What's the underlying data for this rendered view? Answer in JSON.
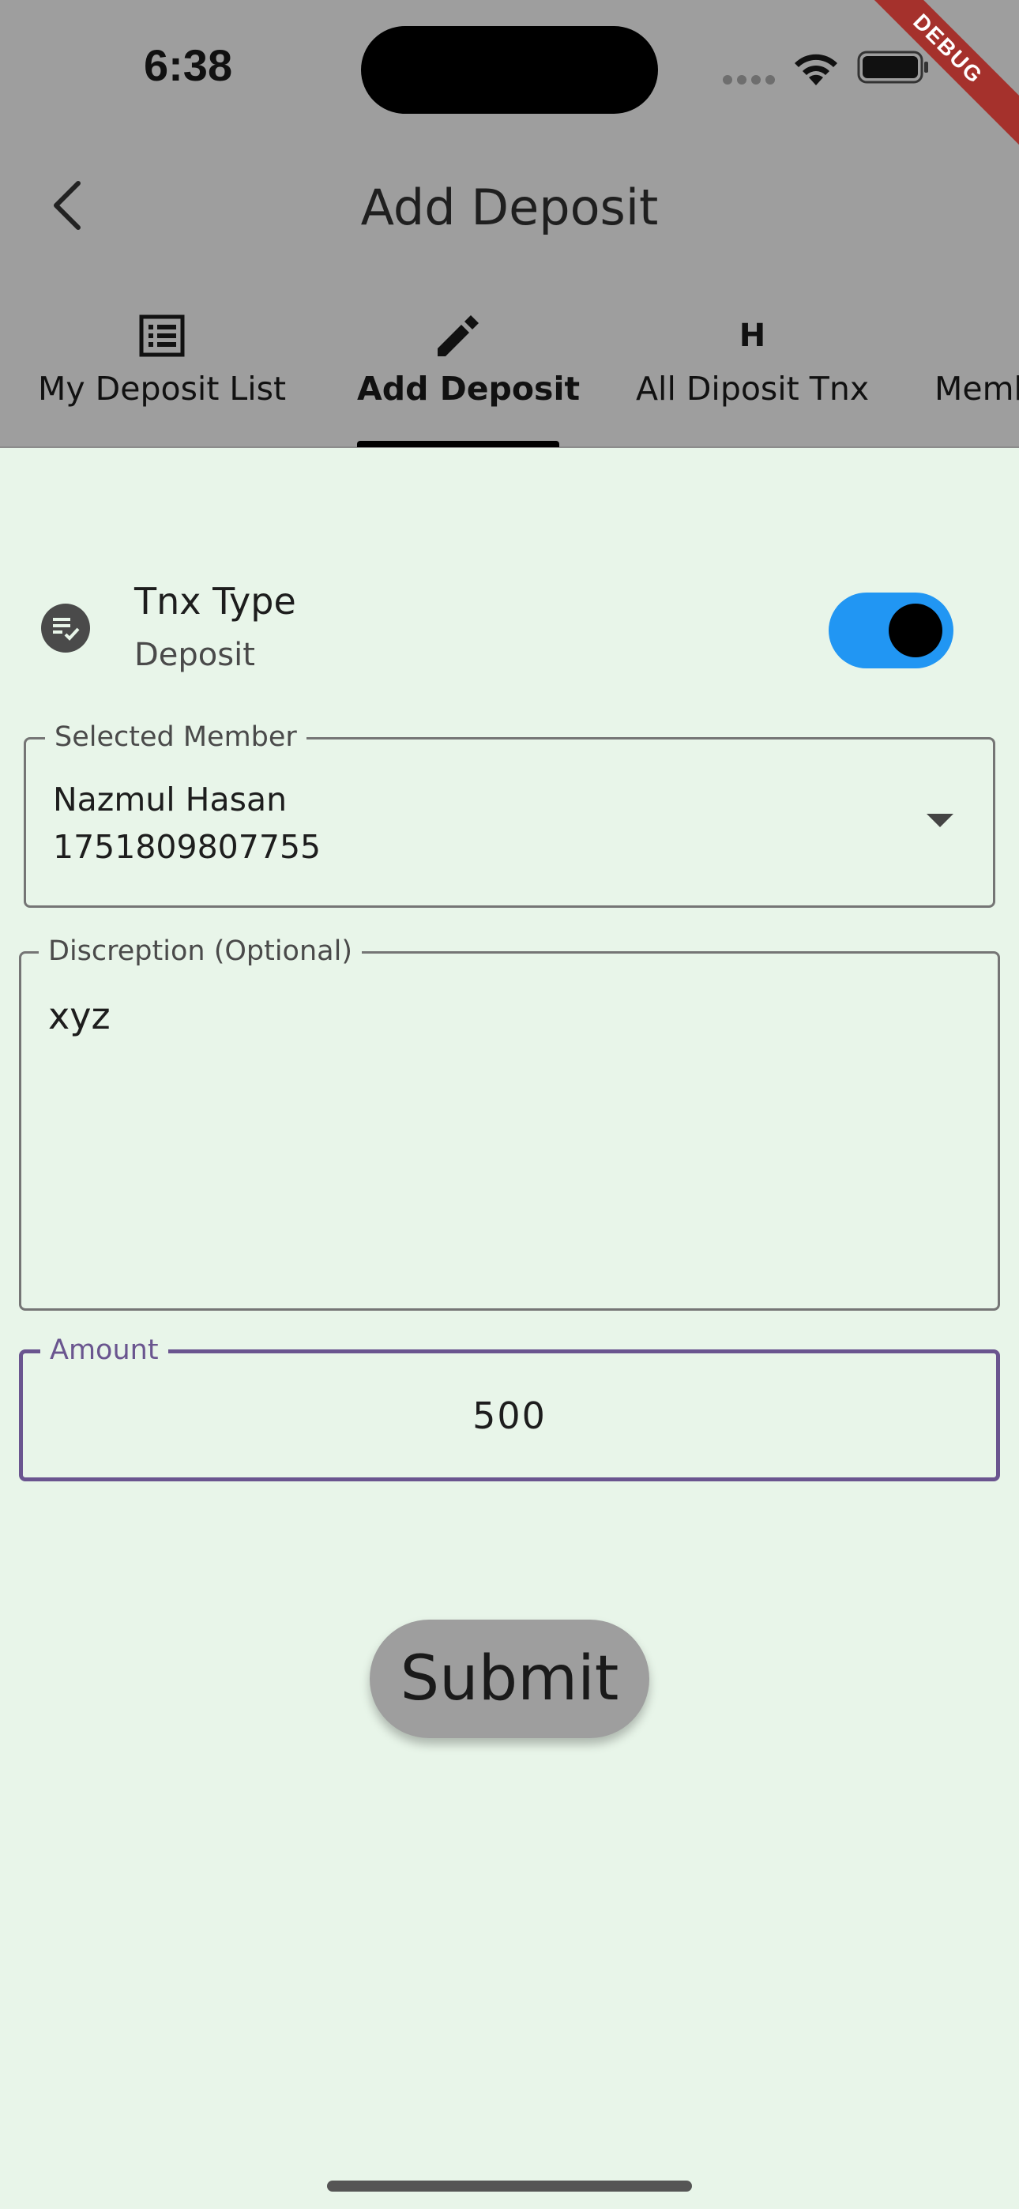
{
  "status_bar": {
    "time": "6:38"
  },
  "debug_banner": "DEBUG",
  "header": {
    "title": "Add Deposit"
  },
  "tabs": [
    {
      "label": "My Deposit List",
      "icon": "list-icon"
    },
    {
      "label": "Add Deposit",
      "icon": "pencil-icon",
      "active": true
    },
    {
      "label": "All Diposit Tnx",
      "icon": "h-icon",
      "icon_text": "H"
    },
    {
      "label": "Memb",
      "icon": ""
    }
  ],
  "tnx_type": {
    "title": "Tnx Type",
    "value": "Deposit",
    "toggle_on": true
  },
  "member_field": {
    "label": "Selected Member",
    "name": "Nazmul Hasan",
    "phone": "1751809807755"
  },
  "description_field": {
    "label": "Discreption (Optional)",
    "value": "xyz"
  },
  "amount_field": {
    "label": "Amount",
    "value": "500"
  },
  "submit_button": {
    "label": "Submit"
  },
  "colors": {
    "app_bar": "#9e9e9e",
    "background": "#e8f5e9",
    "toggle_active": "#2196f3",
    "focused_border": "#6a558f"
  }
}
